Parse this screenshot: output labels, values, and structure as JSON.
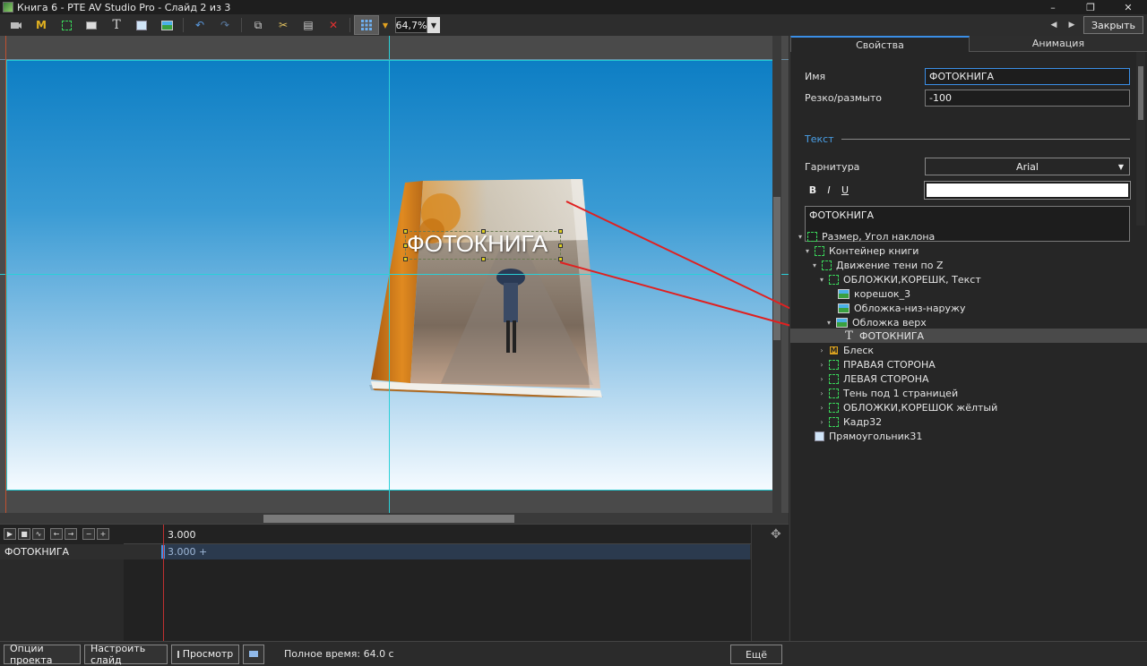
{
  "window": {
    "title": "Книга 6 - PTE AV Studio Pro - Слайд 2 из 3",
    "controls": [
      "–",
      "❐",
      "✕"
    ]
  },
  "toolbar": {
    "zoom": "64,7%",
    "close_label": "Закрыть",
    "text_tool_label": "T",
    "mask_tool_label": "M"
  },
  "slide": {
    "caption": "ФОТОКНИГА"
  },
  "tabs": {
    "properties": "Свойства",
    "animation": "Анимация"
  },
  "properties": {
    "name_label": "Имя",
    "name_value": "ФОТОКНИГА",
    "blur_label": "Резко/размыто",
    "blur_value": "-100",
    "text_section": "Текст",
    "font_label": "Гарнитура",
    "font_value": "Arial",
    "bold": "B",
    "italic": "I",
    "underline": "U",
    "text_value": "ФОТОКНИГА",
    "text_color": "#ffffff"
  },
  "tree": [
    {
      "label": "Размер, Угол наклона",
      "icon": "frame-icon"
    },
    {
      "label": "Контейнер книги",
      "icon": "frame-icon"
    },
    {
      "label": "Движение тени по Z",
      "icon": "frame-icon"
    },
    {
      "label": "ОБЛОЖКИ,КОРЕШК, Текст",
      "icon": "frame-icon"
    },
    {
      "label": "корешок_3",
      "icon": "image-icon"
    },
    {
      "label": "Обложка-низ-наружу",
      "icon": "image-icon"
    },
    {
      "label": "Обложка верх",
      "icon": "image-icon"
    },
    {
      "label": "ФОТОКНИГА",
      "icon": "text-icon"
    },
    {
      "label": "Блеск",
      "icon": "mask-icon"
    },
    {
      "label": "ПРАВАЯ СТОРОНА",
      "icon": "frame-icon"
    },
    {
      "label": "ЛЕВАЯ СТОРОНА",
      "icon": "frame-icon"
    },
    {
      "label": "Тень под 1 страницей",
      "icon": "frame-icon"
    },
    {
      "label": "ОБЛОЖКИ,КОРЕШОК жёлтый",
      "icon": "frame-icon"
    },
    {
      "label": "Кадр32",
      "icon": "frame-icon"
    },
    {
      "label": "Прямоугольник31",
      "icon": "rectangle-icon"
    }
  ],
  "timeline": {
    "time": "3.000",
    "track_label": "ФОТОКНИГА",
    "keyframe_label": "3.000 +"
  },
  "statusbar": {
    "project_options": "Опции проекта",
    "customize_slide": "Настроить слайд",
    "preview": "Просмотр",
    "total_time": "Полное время: 64.0 с",
    "more": "Ещё"
  },
  "colors": {
    "accent": "#3a8ee6",
    "guide": "#2ad0d8",
    "arrow": "#e02020"
  }
}
